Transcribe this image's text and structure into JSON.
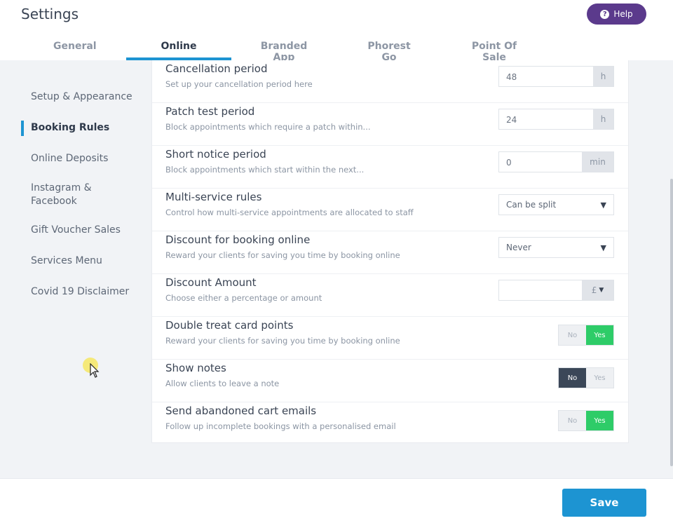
{
  "header": {
    "title": "Settings",
    "help_label": "Help"
  },
  "tabs": [
    {
      "label": "General"
    },
    {
      "label": "Online"
    },
    {
      "label": "Branded App"
    },
    {
      "label": "Phorest Go"
    },
    {
      "label": "Point Of Sale"
    }
  ],
  "active_tab": "Online",
  "sidebar": {
    "items": [
      {
        "label": "Setup & Appearance"
      },
      {
        "label": "Booking Rules"
      },
      {
        "label": "Online Deposits"
      },
      {
        "label": "Instagram & Facebook"
      },
      {
        "label": "Gift Voucher Sales"
      },
      {
        "label": "Services Menu"
      },
      {
        "label": "Covid 19 Disclaimer"
      }
    ],
    "active": "Booking Rules"
  },
  "rules": [
    {
      "title": "Cancellation period",
      "description": "Set up your cancellation period here",
      "value": "48",
      "unit": "h"
    },
    {
      "title": "Patch test period",
      "description": "Block appointments which require a patch within...",
      "value": "24",
      "unit": "h"
    },
    {
      "title": "Short notice period",
      "description": "Block appointments which start within the next...",
      "value": "0",
      "unit": "min"
    },
    {
      "title": "Multi-service rules",
      "description": "Control how multi-service appointments are allocated to staff",
      "selected": "Can be split"
    },
    {
      "title": "Discount for booking online",
      "description": "Reward your clients for saving you time by booking online",
      "selected": "Never"
    },
    {
      "title": "Discount Amount",
      "description": "Choose either a percentage or amount",
      "value": "",
      "unit": "£"
    },
    {
      "title": "Double treat card points",
      "description": "Reward your clients for saving you time by booking online",
      "no_label": "No",
      "yes_label": "Yes",
      "state": "Yes"
    },
    {
      "title": "Show notes",
      "description": "Allow clients to leave a note",
      "no_label": "No",
      "yes_label": "Yes",
      "state": "No"
    },
    {
      "title": "Send abandoned cart emails",
      "description": "Follow up incomplete bookings with a personalised email",
      "no_label": "No",
      "yes_label": "Yes",
      "state": "Yes"
    }
  ],
  "footer": {
    "save_label": "Save"
  },
  "colors": {
    "accent": "#1d94d2",
    "help": "#5b3a8c",
    "toggle_yes": "#2ecc68",
    "toggle_no": "#3b4758"
  },
  "icons": [
    "question-circle-icon",
    "chevron-down-icon",
    "mouse-cursor-icon"
  ]
}
